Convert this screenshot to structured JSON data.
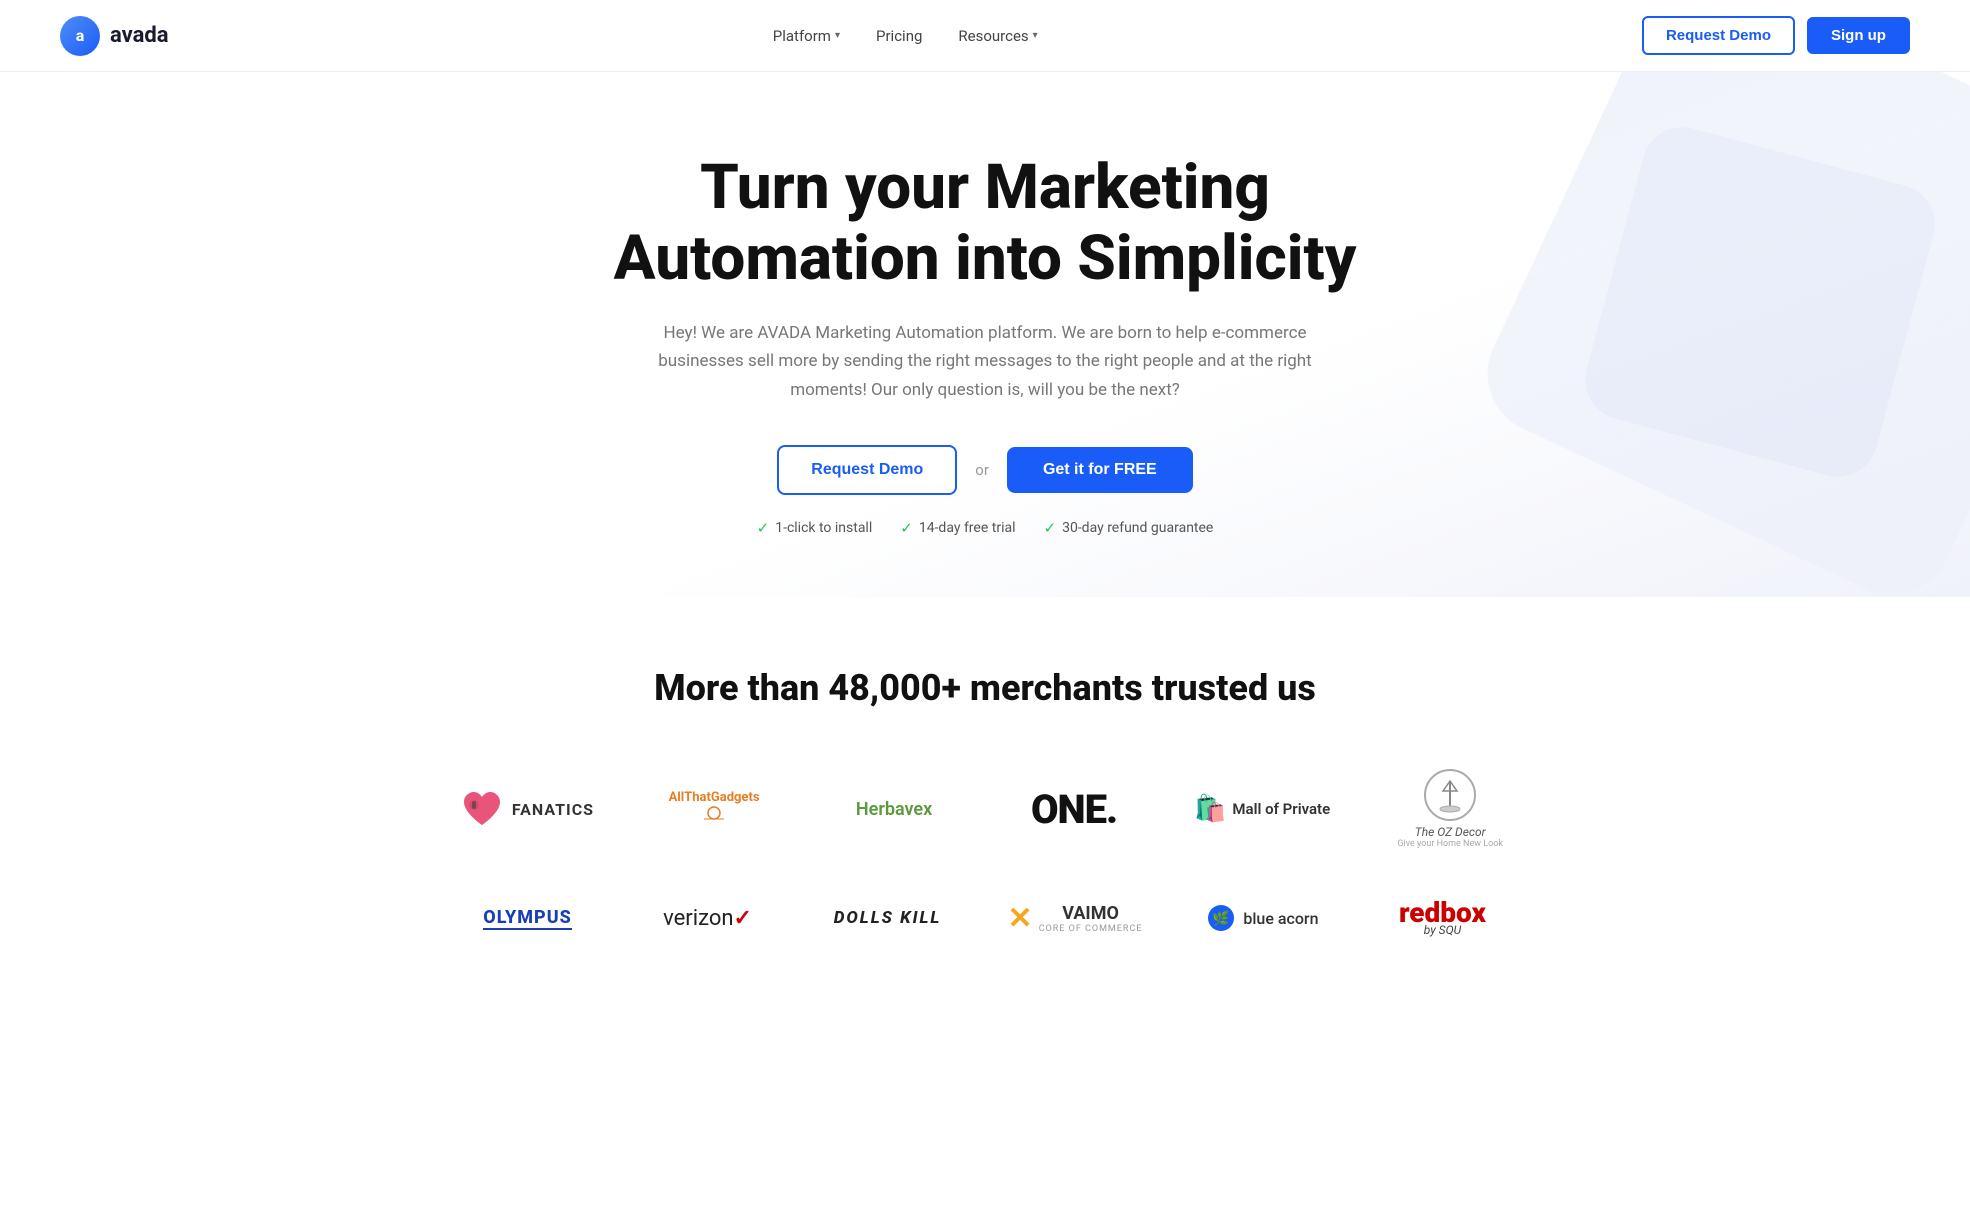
{
  "nav": {
    "logo_letter": "a",
    "logo_name": "avada",
    "links": [
      {
        "label": "Platform",
        "has_dropdown": true
      },
      {
        "label": "Pricing",
        "has_dropdown": false
      },
      {
        "label": "Resources",
        "has_dropdown": true
      }
    ],
    "request_demo": "Request Demo",
    "sign_up": "Sign up"
  },
  "hero": {
    "title": "Turn your Marketing Automation into Simplicity",
    "subtitle": "Hey! We are AVADA Marketing Automation platform. We are born to help e-commerce businesses sell more by sending the right messages to the right people and at the right moments! Our only question is, will you be the next?",
    "cta_demo": "Request Demo",
    "cta_or": "or",
    "cta_free": "Get it for FREE",
    "badge1": "1-click to install",
    "badge2": "14-day free trial",
    "badge3": "30-day refund guarantee"
  },
  "merchants": {
    "title": "More than 48,000+ merchants trusted us",
    "row1": [
      {
        "id": "fanatics",
        "label": "FANATICS"
      },
      {
        "id": "allgadgets",
        "label": "AllThatGadgets"
      },
      {
        "id": "herbavex",
        "label": "Herbavex"
      },
      {
        "id": "one",
        "label": "ONE."
      },
      {
        "id": "mallprivate",
        "label": "Mall of Private"
      },
      {
        "id": "ozdecor",
        "label": "The OZ Decor"
      }
    ],
    "row2": [
      {
        "id": "olympus",
        "label": "OLYMPUS"
      },
      {
        "id": "verizon",
        "label": "verizon"
      },
      {
        "id": "dollskill",
        "label": "DOLLS KILL"
      },
      {
        "id": "vaimo",
        "label": "VAIMO"
      },
      {
        "id": "blueacorn",
        "label": "blue acorn"
      },
      {
        "id": "redbox",
        "label": "redbox by SQU"
      }
    ]
  }
}
